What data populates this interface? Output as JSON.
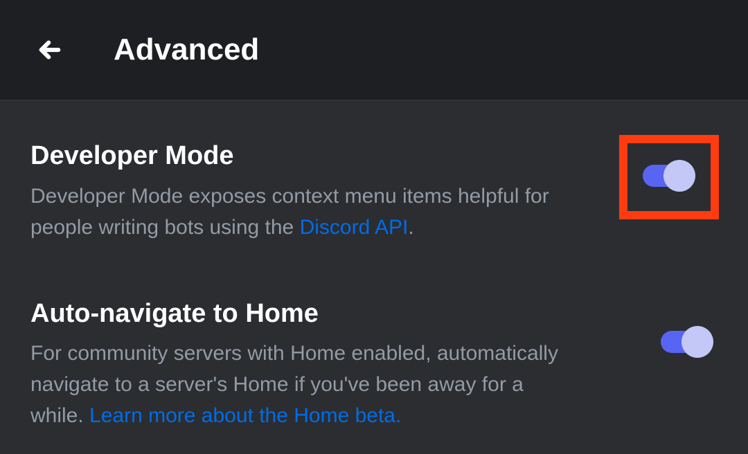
{
  "header": {
    "title": "Advanced"
  },
  "settings": [
    {
      "title": "Developer Mode",
      "desc_prefix": "Developer Mode exposes context menu items helpful for people writing bots using the ",
      "link_text": "Discord API",
      "desc_suffix": ".",
      "highlighted": true,
      "enabled": true
    },
    {
      "title": "Auto-navigate to Home",
      "desc_prefix": "For community servers with Home enabled, automatically navigate to a server's Home if you've been away for a while. ",
      "link_text": "Learn more about the Home beta.",
      "desc_suffix": "",
      "highlighted": false,
      "enabled": true
    }
  ]
}
